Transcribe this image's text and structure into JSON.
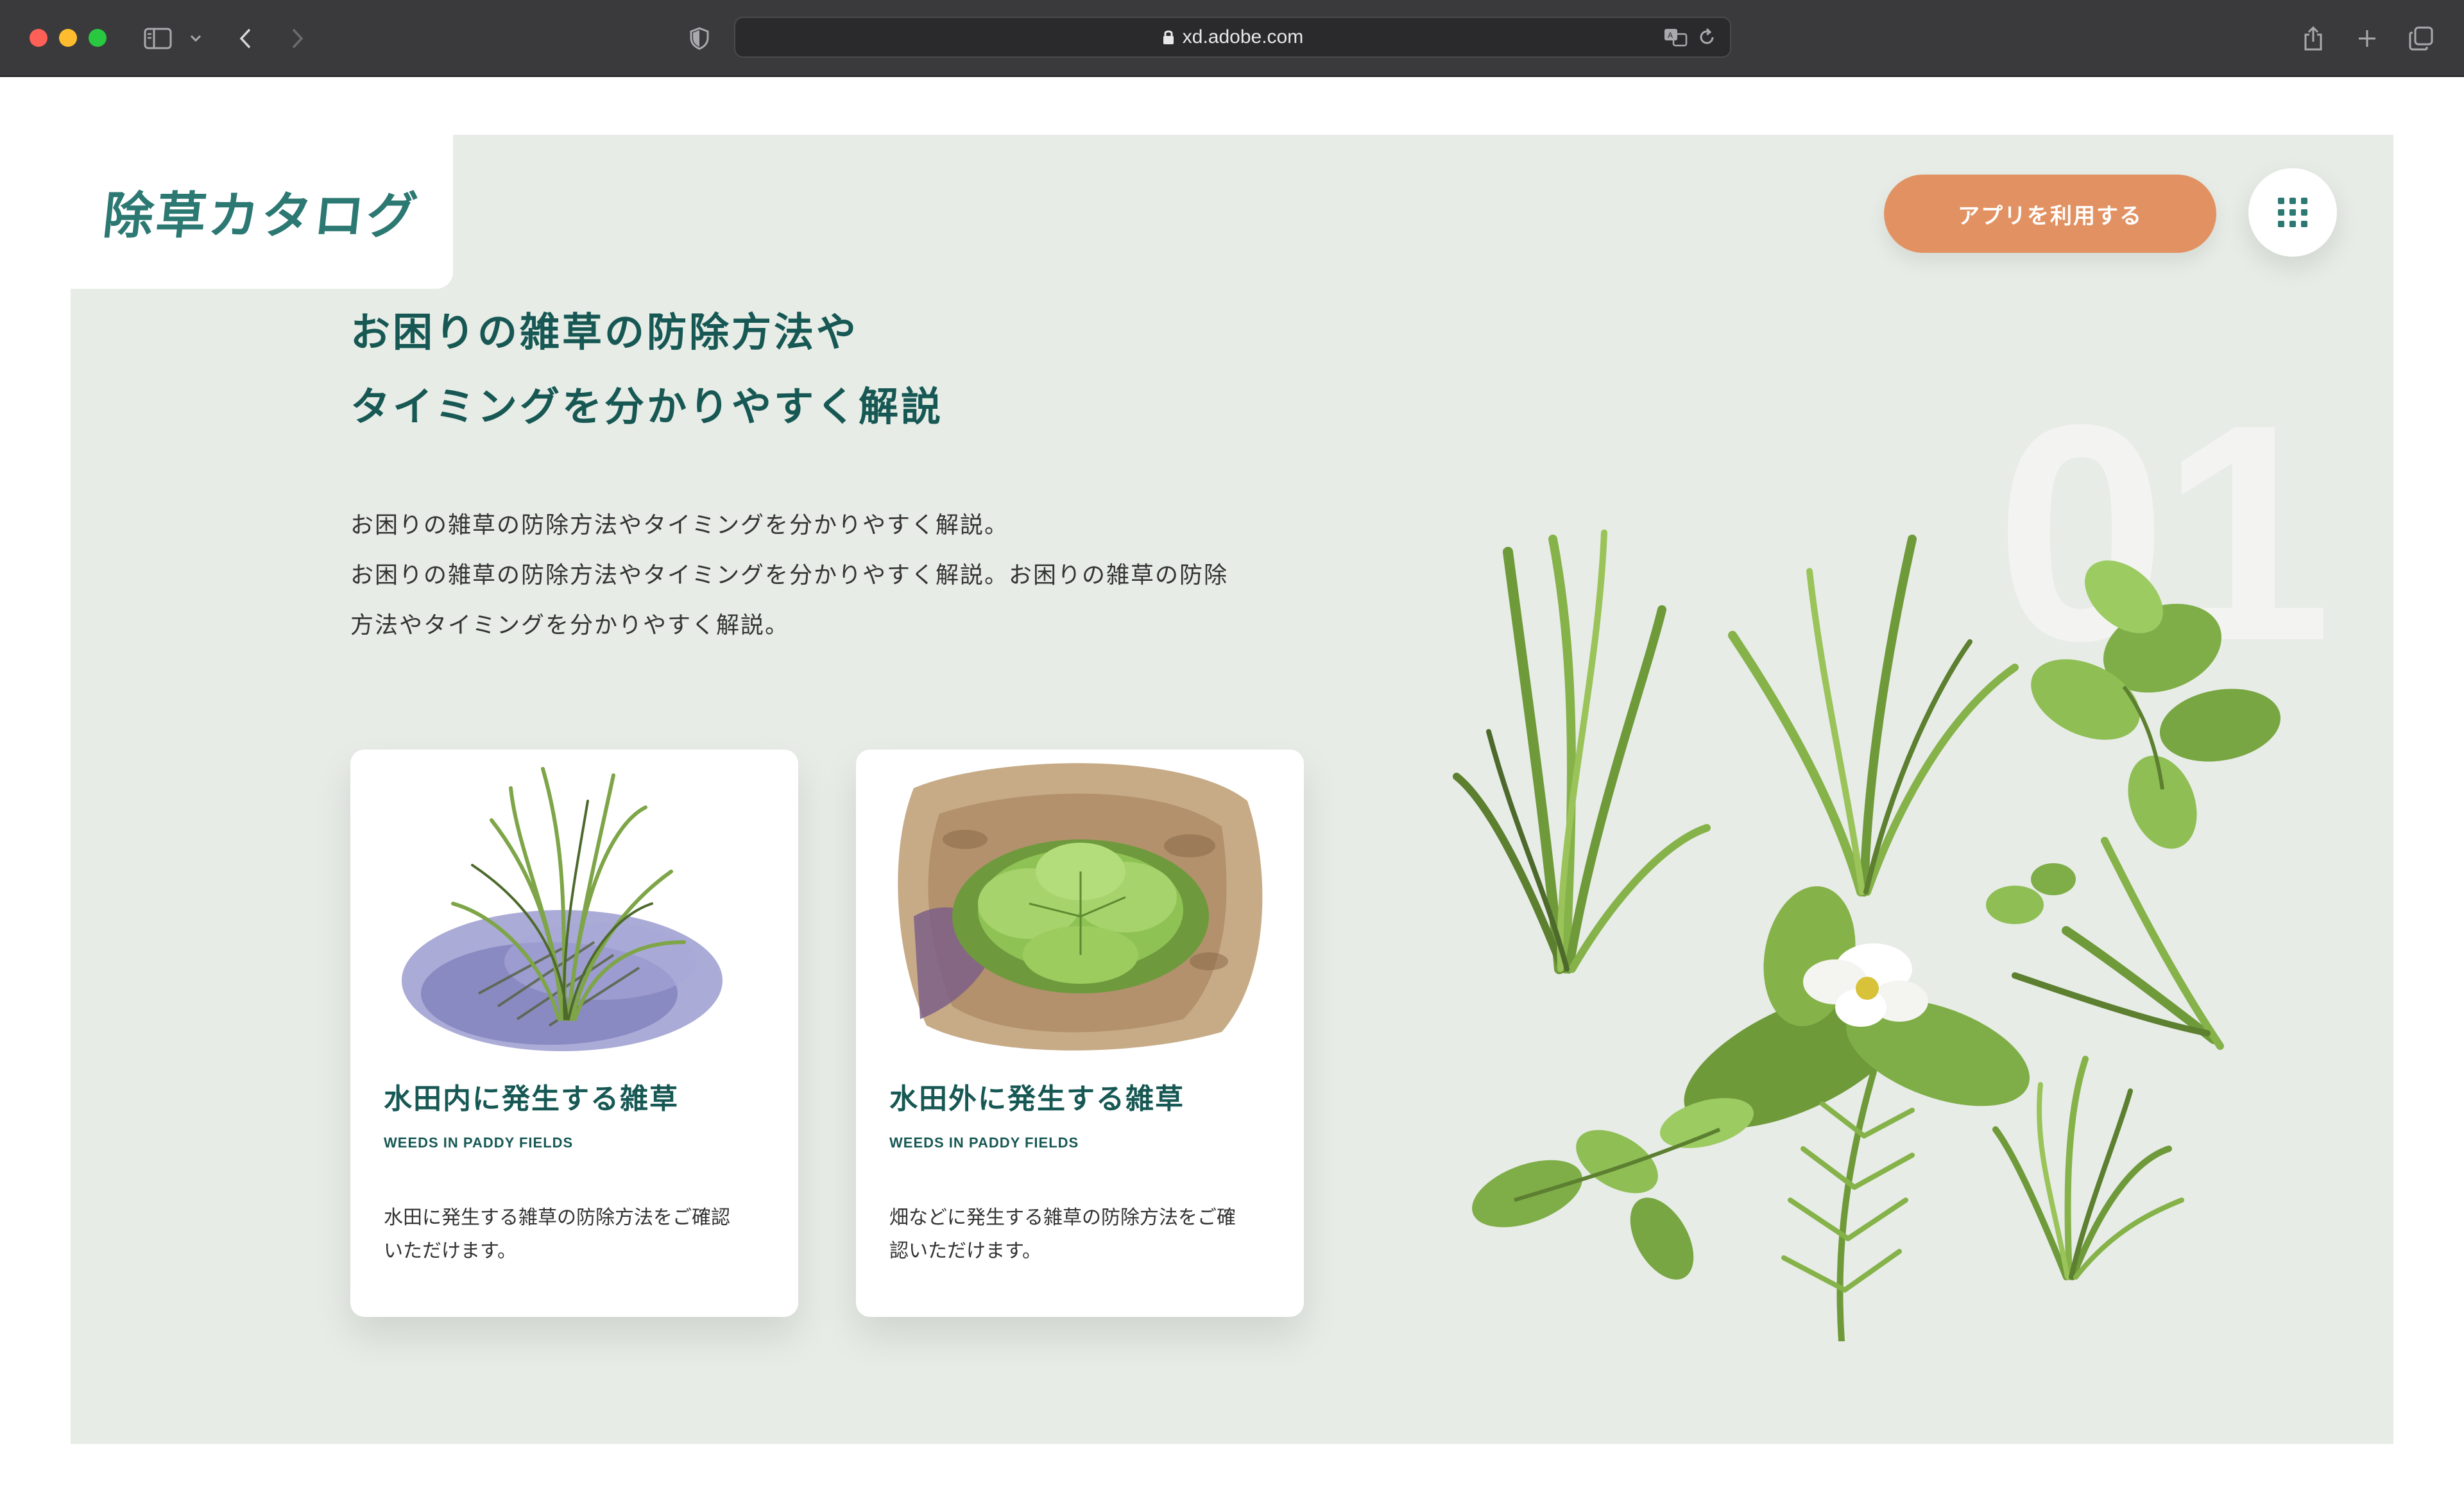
{
  "browser": {
    "url": "xd.adobe.com",
    "icons": [
      "sidebar-icon",
      "chevron-down-icon",
      "back-icon",
      "forward-icon",
      "shield-icon",
      "lock-icon",
      "translate-icon",
      "reload-icon",
      "share-icon",
      "plus-icon",
      "tabs-icon"
    ]
  },
  "header": {
    "logo": "除草カタログ",
    "cta_label": "アプリを利用する",
    "menu_icon": "grid-menu-icon"
  },
  "hero": {
    "headline_line1": "お困りの雑草の防除方法や",
    "headline_line2": "タイミングを分かりやすく解説",
    "body_line1": "お困りの雑草の防除方法やタイミングを分かりやすく解説。",
    "body_line2": "お困りの雑草の防除方法やタイミングを分かりやすく解説。お困りの雑草の防除",
    "body_line3": "方法やタイミングを分かりやすく解説。",
    "big_number": "01"
  },
  "cards": [
    {
      "title": "水田内に発生する雑草",
      "subtitle": "WEEDS IN PADDY FIELDS",
      "desc_line1": "水田に発生する雑草の防除方法をご確認",
      "desc_line2": "いただけます。"
    },
    {
      "title": "水田外に発生する雑草",
      "subtitle": "WEEDS IN PADDY FIELDS",
      "desc_line1": "畑などに発生する雑草の防除方法をご確",
      "desc_line2": "認いただけます。"
    }
  ],
  "colors": {
    "brand_teal": "#2c7872",
    "heading": "#175854",
    "cta": "#e29262",
    "hero_bg": "#e7ece6"
  }
}
